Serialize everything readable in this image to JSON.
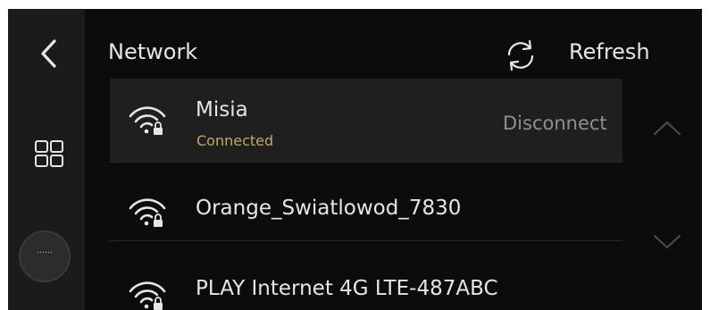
{
  "header": {
    "title": "Network",
    "refresh_label": "Refresh"
  },
  "side_rail": {
    "back_icon": "chevron-left-icon",
    "apps_icon": "grid-icon",
    "more_label": "......"
  },
  "networks": [
    {
      "name": "Misia",
      "status": "Connected",
      "action": "Disconnect",
      "secured": true,
      "active": true
    },
    {
      "name": "Orange_Swiatlowod_7830",
      "secured": true,
      "active": false
    },
    {
      "name": "PLAY Internet 4G LTE-487ABC",
      "secured": true,
      "active": false
    }
  ],
  "scroll": {
    "up_icon": "chevron-up-icon",
    "down_icon": "chevron-down-icon"
  },
  "colors": {
    "background": "#0c0c0c",
    "rail": "#1b1b1b",
    "active_row": "#1f1f1f",
    "text": "#e6e6e6",
    "status": "#c2a66a",
    "muted": "#8f8f8f"
  }
}
